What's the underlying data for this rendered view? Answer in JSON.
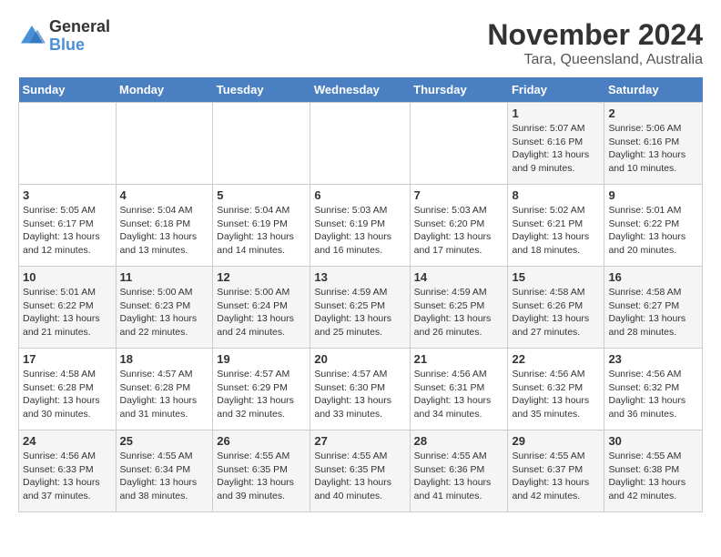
{
  "header": {
    "logo_general": "General",
    "logo_blue": "Blue",
    "month": "November 2024",
    "location": "Tara, Queensland, Australia"
  },
  "weekdays": [
    "Sunday",
    "Monday",
    "Tuesday",
    "Wednesday",
    "Thursday",
    "Friday",
    "Saturday"
  ],
  "weeks": [
    [
      {
        "day": "",
        "info": ""
      },
      {
        "day": "",
        "info": ""
      },
      {
        "day": "",
        "info": ""
      },
      {
        "day": "",
        "info": ""
      },
      {
        "day": "",
        "info": ""
      },
      {
        "day": "1",
        "info": "Sunrise: 5:07 AM\nSunset: 6:16 PM\nDaylight: 13 hours and 9 minutes."
      },
      {
        "day": "2",
        "info": "Sunrise: 5:06 AM\nSunset: 6:16 PM\nDaylight: 13 hours and 10 minutes."
      }
    ],
    [
      {
        "day": "3",
        "info": "Sunrise: 5:05 AM\nSunset: 6:17 PM\nDaylight: 13 hours and 12 minutes."
      },
      {
        "day": "4",
        "info": "Sunrise: 5:04 AM\nSunset: 6:18 PM\nDaylight: 13 hours and 13 minutes."
      },
      {
        "day": "5",
        "info": "Sunrise: 5:04 AM\nSunset: 6:19 PM\nDaylight: 13 hours and 14 minutes."
      },
      {
        "day": "6",
        "info": "Sunrise: 5:03 AM\nSunset: 6:19 PM\nDaylight: 13 hours and 16 minutes."
      },
      {
        "day": "7",
        "info": "Sunrise: 5:03 AM\nSunset: 6:20 PM\nDaylight: 13 hours and 17 minutes."
      },
      {
        "day": "8",
        "info": "Sunrise: 5:02 AM\nSunset: 6:21 PM\nDaylight: 13 hours and 18 minutes."
      },
      {
        "day": "9",
        "info": "Sunrise: 5:01 AM\nSunset: 6:22 PM\nDaylight: 13 hours and 20 minutes."
      }
    ],
    [
      {
        "day": "10",
        "info": "Sunrise: 5:01 AM\nSunset: 6:22 PM\nDaylight: 13 hours and 21 minutes."
      },
      {
        "day": "11",
        "info": "Sunrise: 5:00 AM\nSunset: 6:23 PM\nDaylight: 13 hours and 22 minutes."
      },
      {
        "day": "12",
        "info": "Sunrise: 5:00 AM\nSunset: 6:24 PM\nDaylight: 13 hours and 24 minutes."
      },
      {
        "day": "13",
        "info": "Sunrise: 4:59 AM\nSunset: 6:25 PM\nDaylight: 13 hours and 25 minutes."
      },
      {
        "day": "14",
        "info": "Sunrise: 4:59 AM\nSunset: 6:25 PM\nDaylight: 13 hours and 26 minutes."
      },
      {
        "day": "15",
        "info": "Sunrise: 4:58 AM\nSunset: 6:26 PM\nDaylight: 13 hours and 27 minutes."
      },
      {
        "day": "16",
        "info": "Sunrise: 4:58 AM\nSunset: 6:27 PM\nDaylight: 13 hours and 28 minutes."
      }
    ],
    [
      {
        "day": "17",
        "info": "Sunrise: 4:58 AM\nSunset: 6:28 PM\nDaylight: 13 hours and 30 minutes."
      },
      {
        "day": "18",
        "info": "Sunrise: 4:57 AM\nSunset: 6:28 PM\nDaylight: 13 hours and 31 minutes."
      },
      {
        "day": "19",
        "info": "Sunrise: 4:57 AM\nSunset: 6:29 PM\nDaylight: 13 hours and 32 minutes."
      },
      {
        "day": "20",
        "info": "Sunrise: 4:57 AM\nSunset: 6:30 PM\nDaylight: 13 hours and 33 minutes."
      },
      {
        "day": "21",
        "info": "Sunrise: 4:56 AM\nSunset: 6:31 PM\nDaylight: 13 hours and 34 minutes."
      },
      {
        "day": "22",
        "info": "Sunrise: 4:56 AM\nSunset: 6:32 PM\nDaylight: 13 hours and 35 minutes."
      },
      {
        "day": "23",
        "info": "Sunrise: 4:56 AM\nSunset: 6:32 PM\nDaylight: 13 hours and 36 minutes."
      }
    ],
    [
      {
        "day": "24",
        "info": "Sunrise: 4:56 AM\nSunset: 6:33 PM\nDaylight: 13 hours and 37 minutes."
      },
      {
        "day": "25",
        "info": "Sunrise: 4:55 AM\nSunset: 6:34 PM\nDaylight: 13 hours and 38 minutes."
      },
      {
        "day": "26",
        "info": "Sunrise: 4:55 AM\nSunset: 6:35 PM\nDaylight: 13 hours and 39 minutes."
      },
      {
        "day": "27",
        "info": "Sunrise: 4:55 AM\nSunset: 6:35 PM\nDaylight: 13 hours and 40 minutes."
      },
      {
        "day": "28",
        "info": "Sunrise: 4:55 AM\nSunset: 6:36 PM\nDaylight: 13 hours and 41 minutes."
      },
      {
        "day": "29",
        "info": "Sunrise: 4:55 AM\nSunset: 6:37 PM\nDaylight: 13 hours and 42 minutes."
      },
      {
        "day": "30",
        "info": "Sunrise: 4:55 AM\nSunset: 6:38 PM\nDaylight: 13 hours and 42 minutes."
      }
    ]
  ]
}
